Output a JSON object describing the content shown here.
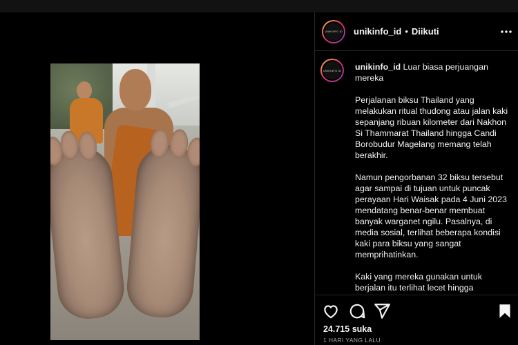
{
  "post": {
    "username": "unikinfo_id",
    "separator": "•",
    "follow_status": "Diikuti",
    "more_icon": "more-horizontal-icon",
    "avatar_text": "UNIKINFO.ID"
  },
  "caption": {
    "username": "unikinfo_id",
    "intro": "Luar biasa perjuangan mereka",
    "paragraphs": [
      "Perjalanan biksu Thailand yang melakukan ritual thudong atau jalan kaki sepanjang ribuan kilometer dari Nakhon Si Thammarat Thailand hingga Candi Borobudur Magelang memang telah berakhir.",
      "Namun pengorbanan 32 biksu tersebut agar sampai di tujuan untuk puncak perayaan Hari Waisak pada 4 Juni 2023 mendatang benar-benar membuat banyak warganet ngilu. Pasalnya, di media sosial, terlihat beberapa kondisi kaki para biksu yang sangat memprihatinkan.",
      "Kaki yang mereka gunakan untuk berjalan itu terlihat lecet hingga"
    ]
  },
  "actions": {
    "like_icon": "heart-icon",
    "comment_icon": "comment-icon",
    "share_icon": "share-icon",
    "save_icon": "bookmark-icon",
    "likes": "24.715 suka",
    "timestamp": "1 HARI YANG LALU"
  },
  "colors": {
    "background": "#000000",
    "border": "#262626",
    "text": "#f5f5f5",
    "muted": "#a8a8a8"
  }
}
